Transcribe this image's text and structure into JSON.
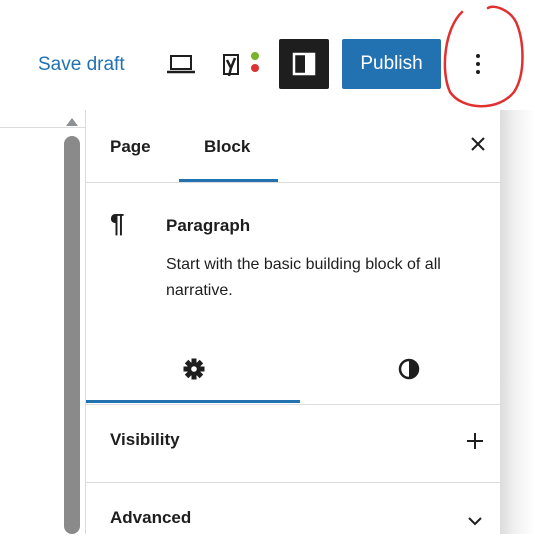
{
  "toolbar": {
    "save_draft_label": "Save draft",
    "preview_icon": "laptop-icon",
    "yoast_icon": "yoast-seo-icon",
    "settings_icon": "sidebar-toggle-icon",
    "publish_label": "Publish",
    "more_icon": "more-vertical-icon"
  },
  "sidebar": {
    "tabs": [
      {
        "label": "Page",
        "active": false
      },
      {
        "label": "Block",
        "active": true
      }
    ],
    "close_icon": "close-icon",
    "block": {
      "icon": "¶",
      "title": "Paragraph",
      "description": "Start with the basic building block of all narrative."
    },
    "subtabs": [
      {
        "icon": "gear-icon",
        "active": true
      },
      {
        "icon": "half-circle-styles-icon",
        "active": false
      }
    ],
    "panels": [
      {
        "label": "Visibility",
        "icon": "plus-icon"
      },
      {
        "label": "Advanced",
        "icon": "chevron-down-icon"
      }
    ]
  },
  "colors": {
    "accent": "#2271b1",
    "dark": "#1e1e1e",
    "annotation": "#e03030",
    "yoast_green": "#77b227",
    "yoast_red": "#dc3232"
  }
}
